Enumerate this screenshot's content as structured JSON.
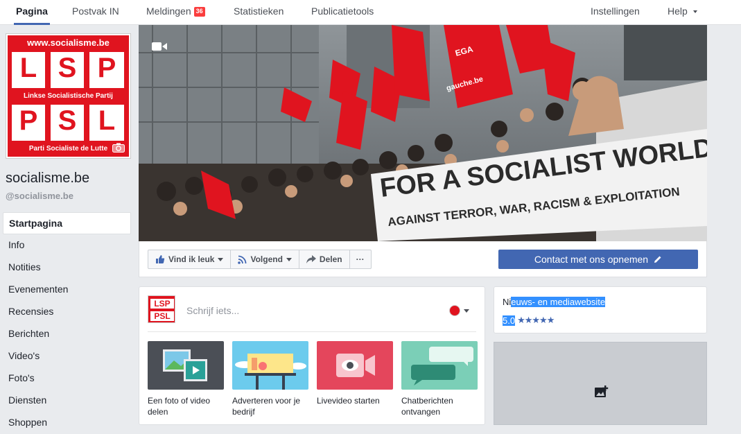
{
  "topbar": {
    "tabs": [
      {
        "label": "Pagina"
      },
      {
        "label": "Postvak IN"
      },
      {
        "label": "Meldingen",
        "badge": "36"
      },
      {
        "label": "Statistieken"
      },
      {
        "label": "Publicatietools"
      }
    ],
    "settings": "Instellingen",
    "help": "Help"
  },
  "profile": {
    "logo_url": "www.socialisme.be",
    "logo_top": "LSP",
    "logo_top_sub": "Linkse Socialistische Partij",
    "logo_bottom": "PSL",
    "logo_bottom_sub": "Parti Socialiste de Lutte",
    "name": "socialisme.be",
    "handle": "@socialisme.be"
  },
  "nav": {
    "items": [
      {
        "label": "Startpagina"
      },
      {
        "label": "Info"
      },
      {
        "label": "Notities"
      },
      {
        "label": "Evenementen"
      },
      {
        "label": "Recensies"
      },
      {
        "label": "Berichten"
      },
      {
        "label": "Video's"
      },
      {
        "label": "Foto's"
      },
      {
        "label": "Diensten"
      },
      {
        "label": "Shoppen"
      }
    ]
  },
  "cover": {
    "banner_line1": "FOR A SOCIALIST WORLD",
    "banner_line2": "AGAINST TERROR, WAR, RACISM & EXPLOITATION",
    "flag_text": "EGA",
    "flag_text2": "gauche.be"
  },
  "actions": {
    "like": "Vind ik leuk",
    "follow": "Volgend",
    "share": "Delen",
    "more": "···",
    "contact": "Contact met ons opnemen"
  },
  "composer": {
    "logo_top": "LSP",
    "logo_bottom": "PSL",
    "placeholder": "Schrijf iets...",
    "tiles": [
      {
        "label": "Een foto of video delen"
      },
      {
        "label": "Adverteren voor je bedrijf"
      },
      {
        "label": "Livevideo starten"
      },
      {
        "label": "Chatberichten ontvangen"
      }
    ]
  },
  "info": {
    "category_prefix": "Ni",
    "category_selected": "euws- en mediawebsite",
    "rating": "5.0",
    "stars": "★★★★★"
  },
  "colors": {
    "accent": "#4267b2",
    "brand_red": "#e0141f",
    "badge": "#fa3e3e"
  }
}
